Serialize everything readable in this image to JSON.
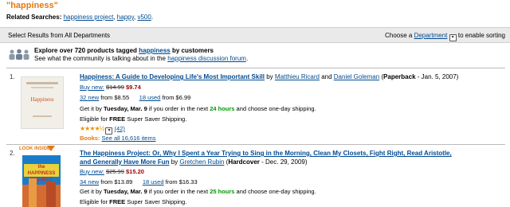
{
  "query": "\"happiness\"",
  "related": {
    "label": "Related Searches:",
    "links": [
      "happiness project",
      "happy",
      "v500"
    ],
    "separators": [
      ",",
      ",",
      "."
    ]
  },
  "topbar": {
    "left": "Select Results from All Departments",
    "right_prefix": "Choose a",
    "right_link": "Department",
    "right_suffix": "to enable sorting"
  },
  "explore": {
    "l1_prefix": "Explore over 720 products tagged",
    "l1_link": "happiness",
    "l1_suffix": "by customers",
    "l2_prefix": "See what the community is talking about in the",
    "l2_link": "happiness discussion forum",
    "l2_suffix": "."
  },
  "results": [
    {
      "num": "1.",
      "title": "Happiness: A Guide to Developing Life's Most Important Skill",
      "by": "by",
      "author1": "Matthieu Ricard",
      "and": "and",
      "author2": "Daniel Goleman",
      "format": "Paperback",
      "date": "- Jan. 5, 2007)",
      "buy_new": "Buy new:",
      "list_price": "$14.99",
      "price": "$9.74",
      "new_count": "32 new",
      "new_from": "from $8.55",
      "used_count": "18 used",
      "used_from": "from $6.99",
      "ship_a": "Get it by",
      "ship_day": "Tuesday, Mar. 9",
      "ship_b": "if you order in the next",
      "ship_hours": "24 hours",
      "ship_c": "and choose one-day shipping.",
      "eligible_a": "Eligible for",
      "eligible_b": "FREE",
      "eligible_c": "Super Saver Shipping.",
      "rating": 4.5,
      "stars": "★★★★½",
      "reviews": "(42)",
      "category_label": "Books:",
      "see_all": "See all 16,616 items",
      "cover_title": "Happiness"
    },
    {
      "num": "2.",
      "title": "The Happiness Project: Or, Why I Spent a Year Trying to Sing in the Morning, Clean My Closets, Fight Right, Read Aristotle,",
      "title2": "and Generally Have More Fun",
      "by": "by",
      "author1": "Gretchen Rubin",
      "format": "Hardcover",
      "date": "- Dec. 29, 2009)",
      "buy_new": "Buy new:",
      "list_price": "$25.99",
      "price": "$15.20",
      "new_count": "34 new",
      "new_from": "from $13.89",
      "used_count": "18 used",
      "used_from": "from $16.33",
      "ship_a": "Get it by",
      "ship_day": "Tuesday, Mar. 9",
      "ship_b": "if you order in the next",
      "ship_hours": "25 hours",
      "ship_c": "and choose one-day shipping.",
      "eligible_a": "Eligible for",
      "eligible_b": "FREE",
      "eligible_c": "Super Saver Shipping.",
      "look_inside": "LOOK INSIDE!",
      "cover_title": "the HAPPINESS PROJECT"
    }
  ]
}
